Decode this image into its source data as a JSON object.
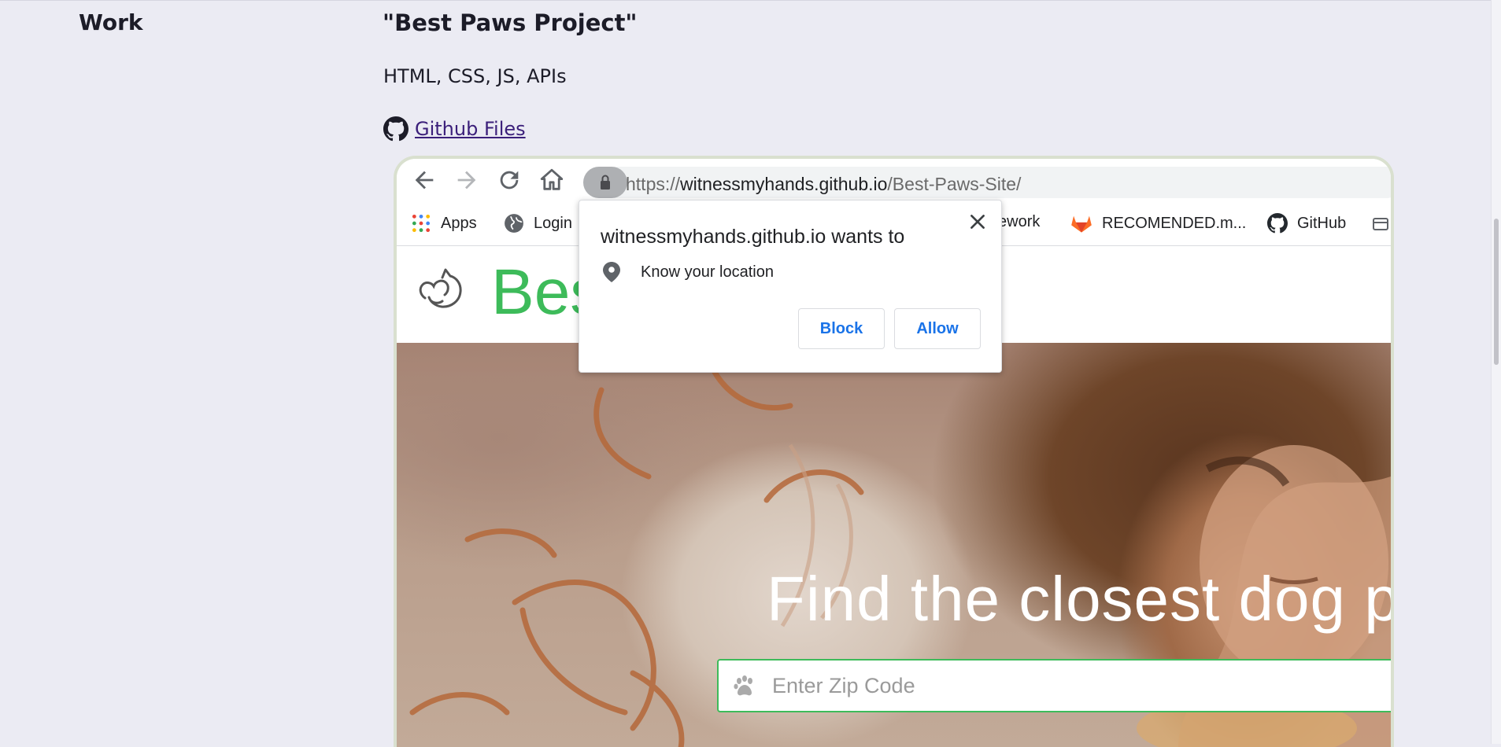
{
  "page": {
    "section_label": "Work",
    "project_title": "\"Best Paws Project\"",
    "tech_stack": "HTML, CSS, JS, APIs",
    "github_link": "Github Files",
    "github_icon": "github-icon"
  },
  "browser": {
    "toolbar_icons": [
      "back-arrow-icon",
      "forward-arrow-icon",
      "reload-icon",
      "home-icon"
    ],
    "url": {
      "scheme": "https://",
      "host": "witnessmyhands.github.io",
      "path": "/Best-Paws-Site/"
    },
    "bookmarks": [
      {
        "label": "Apps",
        "icon": "apps-grid-icon"
      },
      {
        "label": "Login",
        "icon": "globe-icon"
      },
      {
        "label": "ework",
        "icon": ""
      },
      {
        "label": "RECOMENDED.m...",
        "icon": "gitlab-icon"
      },
      {
        "label": "GitHub",
        "icon": "github-icon"
      }
    ]
  },
  "site": {
    "brand_text": "Bes",
    "hero_title": "Find the closest dog p",
    "zip_placeholder": "Enter Zip Code",
    "zip_icon": "paw-icon",
    "brand_color": "#3dbb5a"
  },
  "permission_popup": {
    "title": "witnessmyhands.github.io wants to",
    "request": "Know your location",
    "block_label": "Block",
    "allow_label": "Allow",
    "button_color": "#1a73e8"
  }
}
